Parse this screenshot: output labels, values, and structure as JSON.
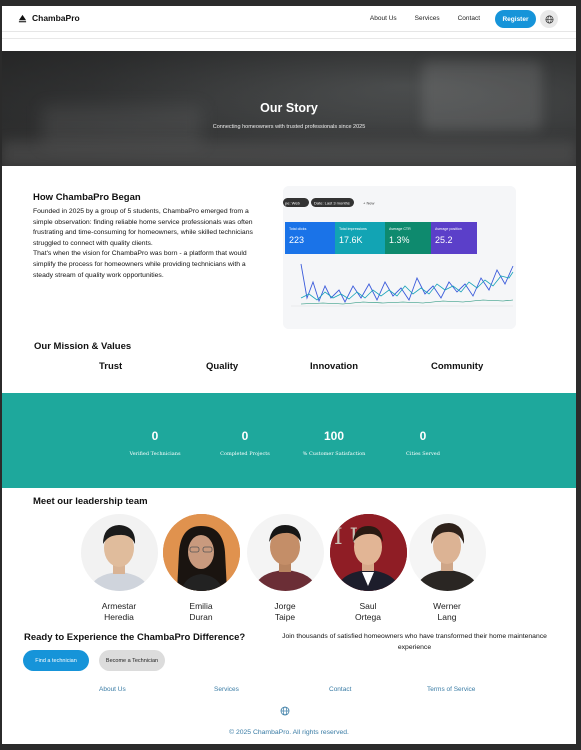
{
  "nav": {
    "logo": "ChambaPro",
    "links": [
      "About Us",
      "Services",
      "Contact"
    ],
    "register": "Register"
  },
  "hero": {
    "title": "Our Story",
    "subtitle": "Connecting homeowners with trusted professionals since 2025"
  },
  "story": {
    "title": "How ChambaPro Began",
    "paragraph1": "Founded in 2025 by a group of 5 students, ChambaPro emerged from a simple observation: finding reliable home service professionals was often frustrating and time-consuming for homeowners, while skilled technicians struggled to connect with quality clients.",
    "paragraph2": "That's when the vision for ChambaPro was born - a platform that would simplify the process for homeowners while providing technicians with a steady stream of quality work opportunities.",
    "dashboard": {
      "chip1": "pe: Web",
      "chip2": "Date: Last 3 months",
      "new": "+ New",
      "cards": [
        {
          "label": "Total clicks",
          "value": "223",
          "color": "#1a73e8"
        },
        {
          "label": "Total impressions",
          "value": "17.6K",
          "color": "#12a4b4"
        },
        {
          "label": "Average CTR",
          "value": "1.3%",
          "color": "#0e8a6e"
        },
        {
          "label": "Average position",
          "value": "25.2",
          "color": "#5b3fc9"
        }
      ]
    }
  },
  "mission": {
    "title": "Our Mission & Values",
    "values": [
      "Trust",
      "Quality",
      "Innovation",
      "Community"
    ]
  },
  "stats": [
    {
      "value": "0",
      "label": "Verified Technicians"
    },
    {
      "value": "0",
      "label": "Completed Projects"
    },
    {
      "value": "100",
      "label": "% Customer Satisfaction"
    },
    {
      "value": "0",
      "label": "Cities Served"
    }
  ],
  "team": {
    "title": "Meet our leadership team",
    "members": [
      {
        "first": "Armestar",
        "last": "Heredia"
      },
      {
        "first": "Emilia",
        "last": "Duran"
      },
      {
        "first": "Jorge",
        "last": "Taipe"
      },
      {
        "first": "Saul",
        "last": "Ortega"
      },
      {
        "first": "Werner",
        "last": "Lang"
      }
    ]
  },
  "cta": {
    "title": "Ready to Experience the ChambaPro Difference?",
    "text": "Join thousands of satisfied homeowners who have transformed their home maintenance experience",
    "find": "Find a technician",
    "become": "Become a Technician"
  },
  "footer": {
    "links": [
      "About Us",
      "Services",
      "Contact",
      "Terms of Service"
    ],
    "copyright": "© 2025 ChambaPro. All rights reserved."
  },
  "colors": {
    "accent": "#1694d9",
    "stats_band": "#1ea89c",
    "footer_link": "#3a7ca5"
  }
}
